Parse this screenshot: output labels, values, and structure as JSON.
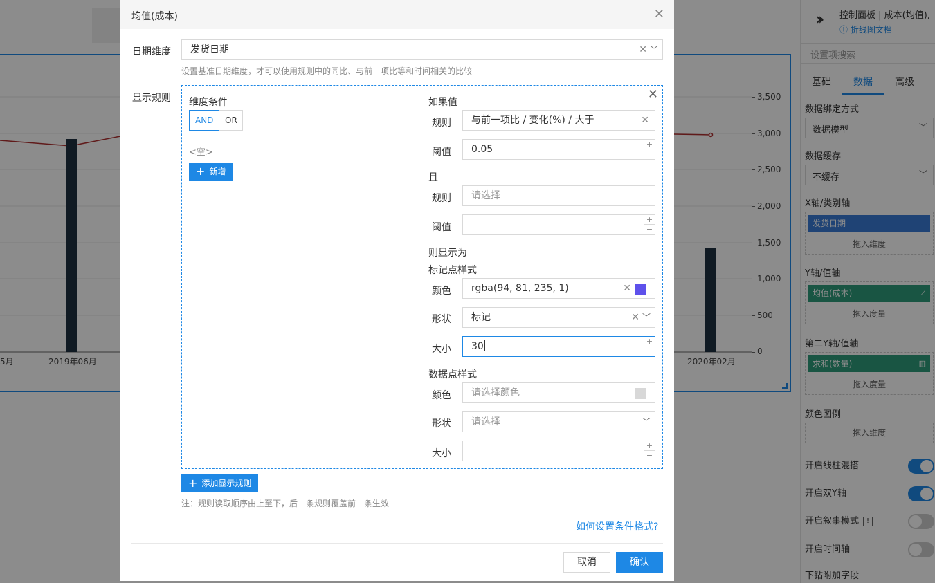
{
  "background": {
    "x_labels": [
      "5月",
      "2019年06月",
      "2020年02月"
    ],
    "y_ticks": [
      "3,500",
      "3,000",
      "2,500",
      "2,000",
      "1,500",
      "1,000",
      "500",
      "0"
    ]
  },
  "right_panel": {
    "title": "控制面板 | 成本(均值),",
    "doc_link": "折线图文档",
    "search_placeholder": "设置项搜索",
    "tabs": [
      "基础",
      "数据",
      "高级"
    ],
    "active_tab": "数据",
    "binding_label": "数据绑定方式",
    "binding_value": "数据模型",
    "cache_label": "数据缓存",
    "cache_value": "不缓存",
    "x_axis_label": "X轴/类别轴",
    "x_axis_chip": "发货日期",
    "x_axis_hint": "拖入维度",
    "y_axis_label": "Y轴/值轴",
    "y_axis_chip": "均值(成本)",
    "y_axis_hint": "拖入度量",
    "y2_axis_label": "第二Y轴/值轴",
    "y2_axis_chip": "求和(数量)",
    "y2_axis_hint": "拖入度量",
    "color_legend_label": "颜色图例",
    "color_legend_hint": "拖入维度",
    "toggles": [
      {
        "label": "开启线柱混搭",
        "on": true
      },
      {
        "label": "开启双Y轴",
        "on": true
      },
      {
        "label": "开启叙事模式",
        "on": false
      },
      {
        "label": "开启时间轴",
        "on": false
      }
    ],
    "drill_label": "下钻附加字段",
    "colors": {
      "accent": "#1e88e5",
      "chip_blue": "#3a7bd5",
      "chip_green": "#2e9c7a"
    }
  },
  "modal": {
    "title": "均值(成本)",
    "date_dim_label": "日期维度",
    "date_dim_value": "发货日期",
    "date_dim_hint": "设置基准日期维度，才可以使用规则中的同比、与前一项比等和时间相关的比较",
    "display_rules_label": "显示规则",
    "dim_condition_label": "维度条件",
    "and_label": "AND",
    "or_label": "OR",
    "empty_label": "<空>",
    "add_button": "新增",
    "if_value_label": "如果值",
    "rule_label": "规则",
    "rule_value": "与前一项比 / 变化(%) / 大于",
    "threshold_label": "阈值",
    "threshold_value": "0.05",
    "and_cn_label": "且",
    "rule2_placeholder": "请选择",
    "then_show_label": "则显示为",
    "marker_style_label": "标记点样式",
    "color_label": "颜色",
    "marker_color_value": "rgba(94, 81, 235, 1)",
    "marker_color_hex": "#5e51eb",
    "shape_label": "形状",
    "marker_shape_value": "标记",
    "size_label": "大小",
    "marker_size_value": "30",
    "data_point_style_label": "数据点样式",
    "dp_color_placeholder": "请选择颜色",
    "dp_shape_placeholder": "请选择",
    "add_rule_button": "添加显示规则",
    "note": "注：规则读取顺序由上至下，后一条规则覆盖前一条生效",
    "help_link": "如何设置条件格式?",
    "cancel_button": "取消",
    "confirm_button": "确认"
  }
}
